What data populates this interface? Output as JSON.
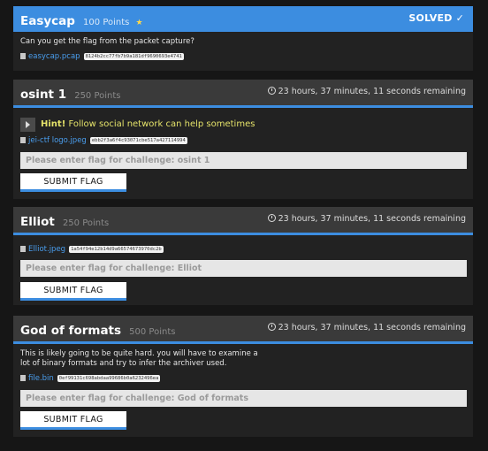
{
  "challenges": [
    {
      "title": "Easycap",
      "points": "100 Points",
      "star": "★",
      "status": "SOLVED ✓",
      "description": "Can you get the flag from the packet capture?",
      "file": "easycap.pcap",
      "hash": "8124b2cc77fb7b9a181df9690693e4741"
    },
    {
      "title": "osint 1",
      "points": "250 Points",
      "time_remaining": "23 hours, 37 minutes, 11 seconds remaining",
      "hint_label": "Hint!",
      "hint_text": "Follow social network can help sometimes",
      "file": "jei-ctf logo.jpeg",
      "hash": "ebb2f3a6f4c93071cbe517a427114994",
      "placeholder": "Please enter flag for challenge: osint 1",
      "submit": "SUBMIT FLAG"
    },
    {
      "title": "Elliot",
      "points": "250 Points",
      "time_remaining": "23 hours, 37 minutes, 11 seconds remaining",
      "file": "Elliot.jpeg",
      "hash": "1a54f94e12b14d9a66574673970dc2b",
      "placeholder": "Please enter flag for challenge: Elliot",
      "submit": "SUBMIT FLAG"
    },
    {
      "title": "God of formats",
      "points": "500 Points",
      "time_remaining": "23 hours, 37 minutes, 11 seconds remaining",
      "description_line1": "This is likely going to be quite hard. you will have to examine a",
      "description_line2": "lot of binary formats and try to infer the archiver used.",
      "file": "file.bin",
      "hash": "0ef99131c698abdaa99686b0a6232496ea",
      "placeholder": "Please enter flag for challenge: God of formats",
      "submit": "SUBMIT FLAG"
    }
  ],
  "colors": {
    "accent": "#3c8de0",
    "hint": "#e5e36a",
    "link": "#4a9eee",
    "star": "#ffd84a"
  },
  "icons": {
    "file": "file-icon",
    "clock": "clock-icon",
    "hint_toggle": "chevron-right-icon",
    "solved": "check-icon"
  }
}
